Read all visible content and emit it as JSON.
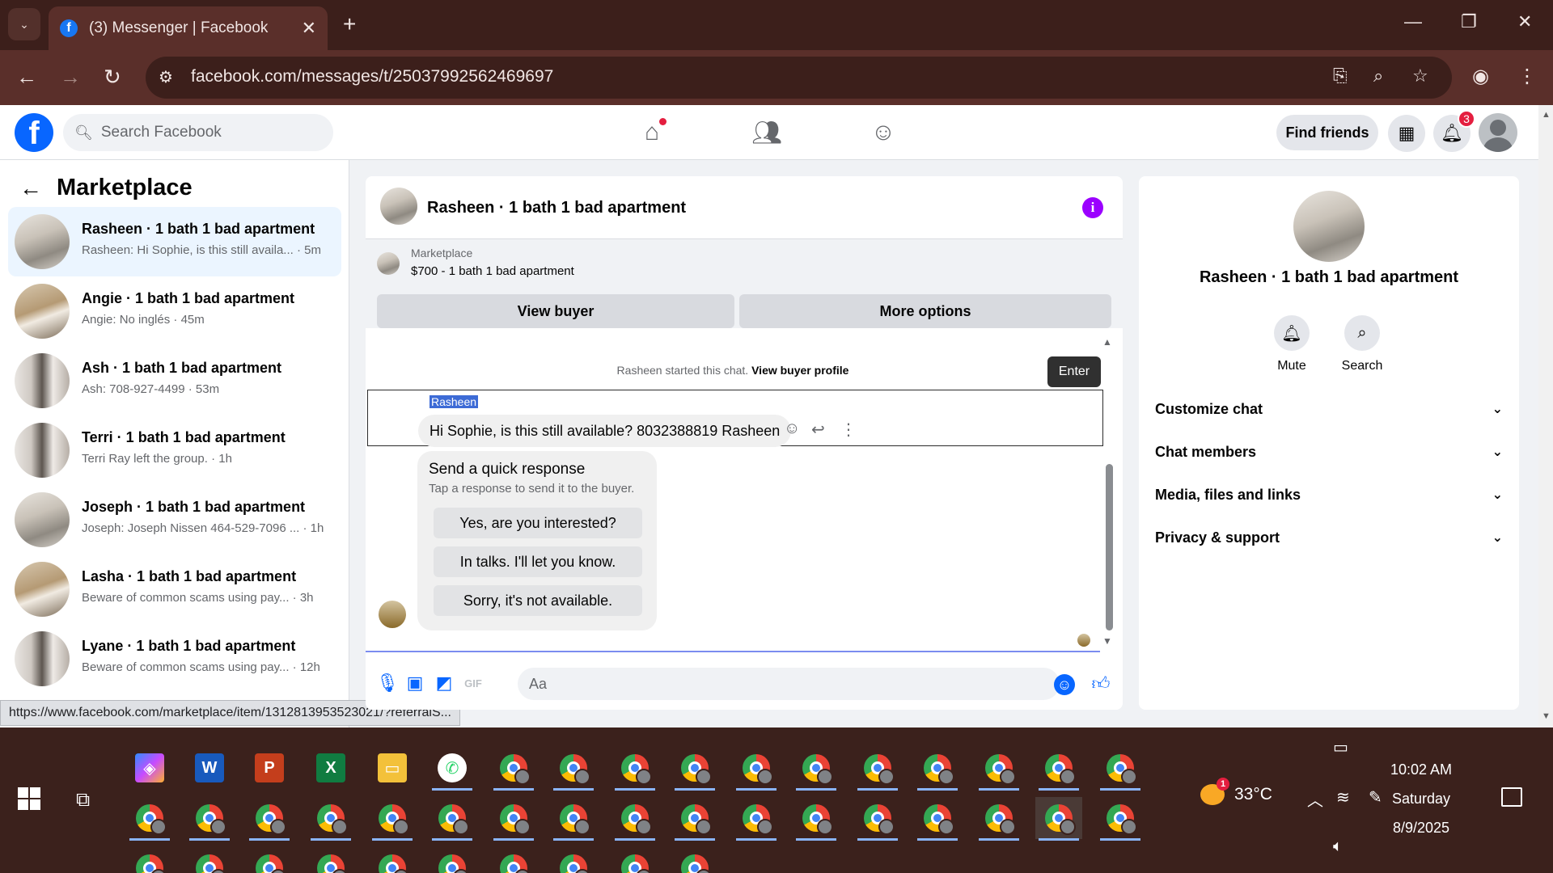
{
  "browser": {
    "tab_title": "(3) Messenger | Facebook",
    "tab_favicon": "f",
    "url": "facebook.com/messages/t/25037992562469697",
    "status_url": "https://www.facebook.com/marketplace/item/1312813953523021/?referralS..."
  },
  "fb": {
    "logo": "f",
    "search_placeholder": "Search Facebook",
    "find_friends": "Find friends",
    "notifications_count": "3"
  },
  "sidebar": {
    "title": "Marketplace",
    "conversations": [
      {
        "name": "Rasheen · 1 bath 1 bad apartment",
        "preview": "Rasheen: Hi Sophie, is this still availa... · 5m"
      },
      {
        "name": "Angie · 1 bath 1 bad apartment",
        "preview": "Angie: No inglés · 45m"
      },
      {
        "name": "Ash · 1 bath 1 bad apartment",
        "preview": "Ash: 708-927-4499 · 53m"
      },
      {
        "name": "Terri · 1 bath 1 bad apartment",
        "preview": "Terri Ray left the group. · 1h"
      },
      {
        "name": "Joseph · 1 bath 1 bad apartment",
        "preview": "Joseph: Joseph Nissen 464-529-7096 ... · 1h"
      },
      {
        "name": "Lasha · 1 bath 1 bad apartment",
        "preview": "Beware of common scams using pay... · 3h"
      },
      {
        "name": "Lyane · 1 bath 1 bad apartment",
        "preview": "Beware of common scams using pay... · 12h"
      }
    ]
  },
  "chat": {
    "title": "Rasheen · 1 bath 1 bad apartment",
    "marketplace_label": "Marketplace",
    "listing": "$700 - 1 bath 1 bad apartment",
    "view_buyer": "View buyer",
    "more_options": "More options",
    "started_text": "Rasheen started this chat.",
    "view_buyer_profile": "View buyer profile",
    "tooltip": "Enter",
    "sender": "Rasheen",
    "message": "Hi Sophie, is this still available? 8032388819 Rasheen",
    "quick_title": "Send a quick response",
    "quick_sub": "Tap a response to send it to the buyer.",
    "quick_responses": [
      "Yes, are you interested?",
      "In talks. I'll let you know.",
      "Sorry, it's not available."
    ],
    "composer_placeholder": "Aa",
    "gif_label": "GIF"
  },
  "info": {
    "name": "Rasheen · 1 bath 1 bad apartment",
    "mute": "Mute",
    "search": "Search",
    "sections": [
      "Customize chat",
      "Chat members",
      "Media, files and links",
      "Privacy & support"
    ]
  },
  "taskbar": {
    "weather": "33°C",
    "weather_badge": "1",
    "time": "10:02 AM",
    "day": "Saturday",
    "date": "8/9/2025",
    "word_label": "W",
    "ppt_label": "P",
    "excel_label": "X"
  },
  "colors": {
    "facebook_blue": "#0866ff",
    "browser_frame": "#5a2f2a",
    "notification_red": "#e41e3f",
    "info_purple": "#9b00ff"
  }
}
